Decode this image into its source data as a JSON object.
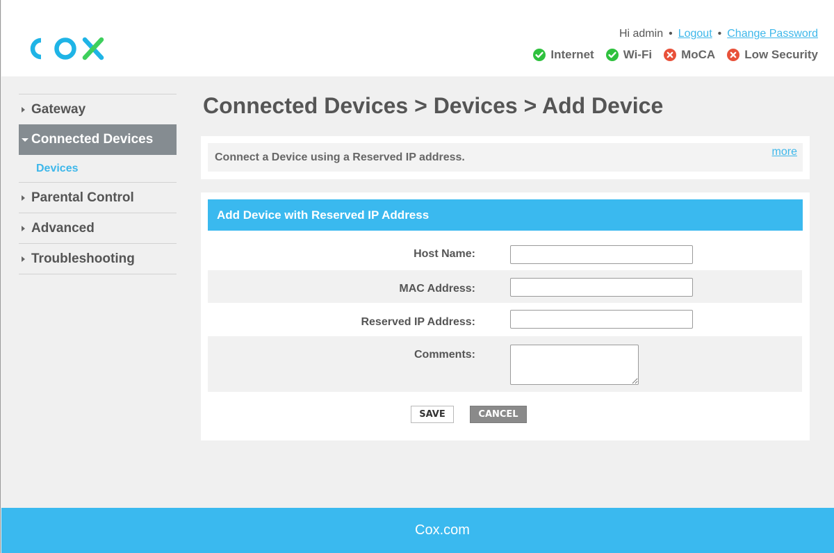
{
  "brand": {
    "logo_text": "COX",
    "logo_color": "#1fb4e6",
    "logo_accent": "#3ecf5c"
  },
  "header": {
    "greeting": "Hi admin",
    "separator": "•",
    "logout": "Logout",
    "change_password": "Change Password",
    "status": [
      {
        "label": "Internet",
        "state": "ok",
        "icon": "check-circle-icon"
      },
      {
        "label": "Wi-Fi",
        "state": "ok",
        "icon": "check-circle-icon"
      },
      {
        "label": "MoCA",
        "state": "error",
        "icon": "x-circle-icon"
      },
      {
        "label": "Low Security",
        "state": "error",
        "icon": "x-circle-icon"
      }
    ]
  },
  "sidebar": {
    "items": [
      {
        "label": "Gateway",
        "active": false
      },
      {
        "label": "Connected Devices",
        "active": true,
        "children": [
          {
            "label": "Devices"
          }
        ]
      },
      {
        "label": "Parental Control",
        "active": false
      },
      {
        "label": "Advanced",
        "active": false
      },
      {
        "label": "Troubleshooting",
        "active": false
      }
    ]
  },
  "main": {
    "title": "Connected Devices > Devices > Add Device",
    "info": {
      "text": "Connect a Device using a Reserved IP address.",
      "more": "more"
    },
    "form": {
      "heading": "Add Device with Reserved IP Address",
      "host_name": {
        "label": "Host Name:",
        "value": ""
      },
      "mac_address": {
        "label": "MAC Address:",
        "value": ""
      },
      "reserved_ip": {
        "label": "Reserved IP Address:",
        "value": ""
      },
      "comments": {
        "label": "Comments:",
        "value": ""
      },
      "save": "SAVE",
      "cancel": "CANCEL"
    }
  },
  "footer": {
    "link": "Cox.com"
  },
  "colors": {
    "accent": "#3ab9ef",
    "ok": "#2fc13e",
    "error": "#e8513a",
    "nav_active": "#858c91"
  }
}
